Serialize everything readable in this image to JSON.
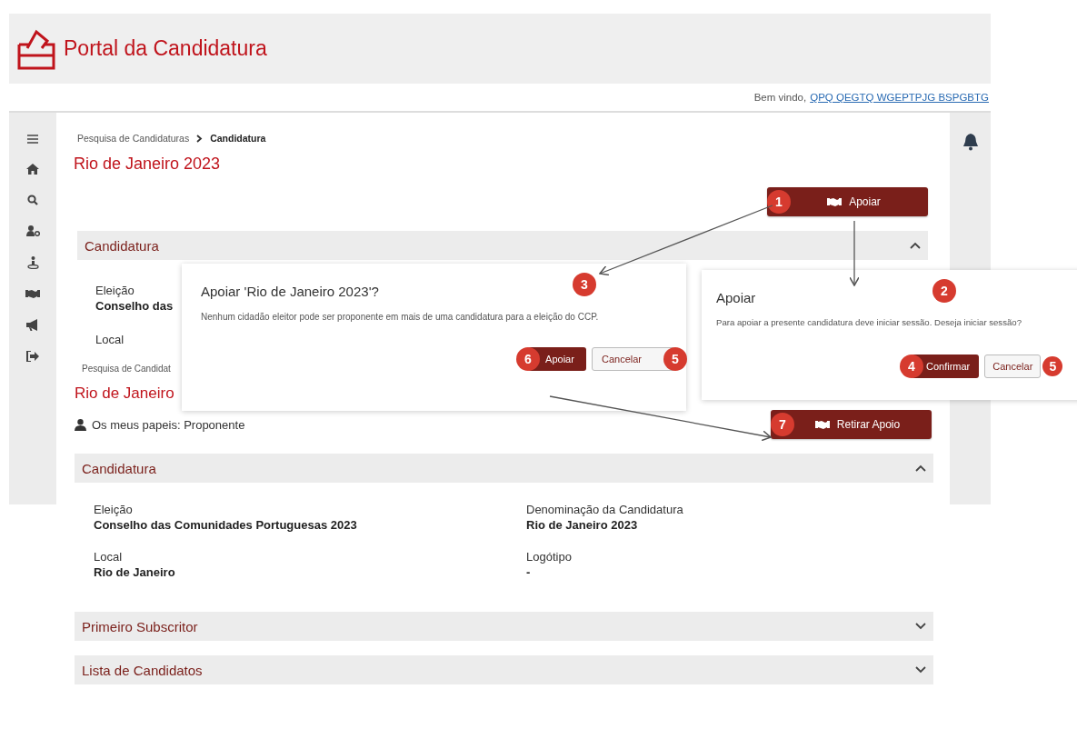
{
  "header": {
    "title": "Portal da Candidatura"
  },
  "welcome": {
    "label": "Bem vindo,",
    "user": "QPQ QEGTQ WGEPTPJG BSPGBTG"
  },
  "page": {
    "breadcrumb": [
      "Pesquisa de Candidaturas",
      "Candidatura"
    ],
    "title": "Rio de Janeiro 2023",
    "action": {
      "label": "Apoiar",
      "step": "1"
    },
    "section": {
      "title": "Candidatura",
      "expanded": true
    },
    "fields": [
      {
        "label": "Eleição",
        "value": "Conselho das"
      },
      {
        "label": "Local"
      }
    ]
  },
  "result_page": {
    "breadcrumb": "Pesquisa de Candidat",
    "title": "Rio de Janeiro",
    "roles": "Os meus papeis: Proponente",
    "action": {
      "label": "Retirar Apoio",
      "step": "7"
    },
    "sections": [
      {
        "title": "Candidatura",
        "expanded": true,
        "fields": [
          {
            "label": "Eleição",
            "value": "Conselho das Comunidades Portuguesas 2023"
          },
          {
            "label": "Denominação da Candidatura",
            "value": "Rio de Janeiro 2023"
          },
          {
            "label": "Local",
            "value": "Rio de Janeiro"
          },
          {
            "label": "Logótipo",
            "value": "-"
          }
        ]
      },
      {
        "title": "Primeiro Subscritor",
        "expanded": false
      },
      {
        "title": "Lista de Candidatos",
        "expanded": false
      }
    ]
  },
  "dialogs": [
    {
      "title": "Apoiar 'Rio de Janeiro 2023'?",
      "step": "3",
      "message": "Nenhum cidadão eleitor pode ser proponente em mais de uma candidatura para a eleição do CCP.",
      "buttons": [
        {
          "label": "Apoiar",
          "kind": "primary",
          "step": "6"
        },
        {
          "label": "Cancelar",
          "kind": "secondary",
          "step": "5"
        }
      ]
    },
    {
      "title": "Apoiar",
      "step": "2",
      "message": "Para apoiar a presente candidatura deve iniciar sessão. Deseja iniciar sessão?",
      "buttons": [
        {
          "label": "Confirmar",
          "kind": "primary",
          "step": "4"
        },
        {
          "label": "Cancelar",
          "kind": "secondary",
          "step": "5"
        }
      ]
    }
  ]
}
